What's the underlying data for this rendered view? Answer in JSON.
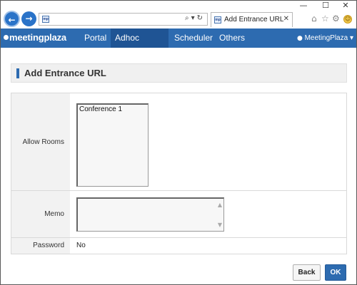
{
  "window": {
    "minimize_glyph": "—",
    "maximize_glyph": "☐",
    "close_glyph": "✕"
  },
  "browser": {
    "back_glyph": "←",
    "forward_glyph": "→",
    "address_value": "",
    "address_icons": "⌕▾↻",
    "favicon_text": "mp",
    "tab_title": "Add Entrance URL",
    "tab_close_glyph": "✕",
    "icons": [
      "home-icon",
      "star-icon",
      "gear-icon",
      "smiley-icon"
    ],
    "home_glyph": "⌂",
    "star_glyph": "☆",
    "gear_glyph": "⚙",
    "smile_glyph": "☺"
  },
  "navbar": {
    "logo": "meetingplaza",
    "items": [
      {
        "label": "Portal",
        "active": false
      },
      {
        "label": "Adhoc Rooms",
        "active": true
      },
      {
        "label": "Scheduler",
        "active": false
      },
      {
        "label": "Others",
        "active": false
      }
    ],
    "user_label": "MeetingPlaza",
    "user_icon": "👤",
    "caret": "▾",
    "bg_color": "#2d6bb0",
    "active_color": "#1f5494"
  },
  "page": {
    "title": "Add Entrance URL"
  },
  "form": {
    "allow_rooms_label": "Allow Rooms",
    "allow_rooms_options": [
      "Conference 1"
    ],
    "memo_label": "Memo",
    "memo_value": "",
    "password_label": "Password",
    "password_value": "No"
  },
  "buttons": {
    "back_label": "Back",
    "ok_label": "OK"
  }
}
